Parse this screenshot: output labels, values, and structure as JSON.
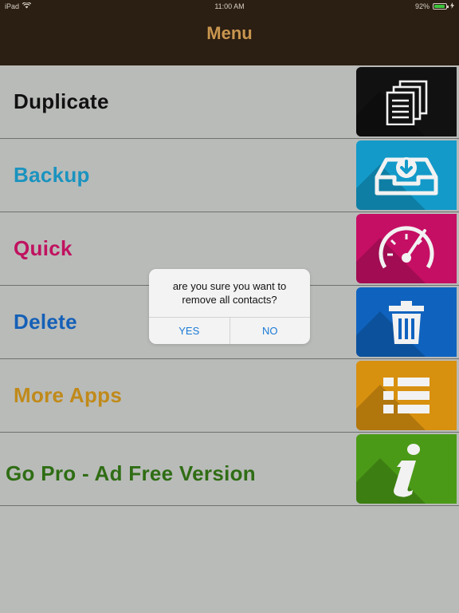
{
  "status": {
    "device": "iPad",
    "time": "11:00 AM",
    "battery": "92%",
    "battery_level": 0.92
  },
  "nav": {
    "title": "Menu"
  },
  "menu": {
    "items": [
      {
        "label": "Duplicate",
        "color": "#111111",
        "tile_color": "#111111",
        "icon": "copy-documents-icon"
      },
      {
        "label": "Backup",
        "color": "#1a93bf",
        "tile_color": "#139ac9",
        "icon": "download-tray-icon"
      },
      {
        "label": "Quick",
        "color": "#c0125f",
        "tile_color": "#c50f64",
        "icon": "speedometer-icon"
      },
      {
        "label": "Delete",
        "color": "#1560b7",
        "tile_color": "#0f63bf",
        "icon": "trash-icon"
      },
      {
        "label": "More Apps",
        "color": "#c08a1a",
        "tile_color": "#d8900f",
        "icon": "list-icon"
      },
      {
        "label": "Go Pro - Ad Free Version",
        "color": "#2f6d14",
        "tile_color": "#4b9a17",
        "icon": "info-icon"
      }
    ]
  },
  "alert": {
    "message": "are you sure you want to remove all contacts?",
    "yes": "YES",
    "no": "NO"
  }
}
